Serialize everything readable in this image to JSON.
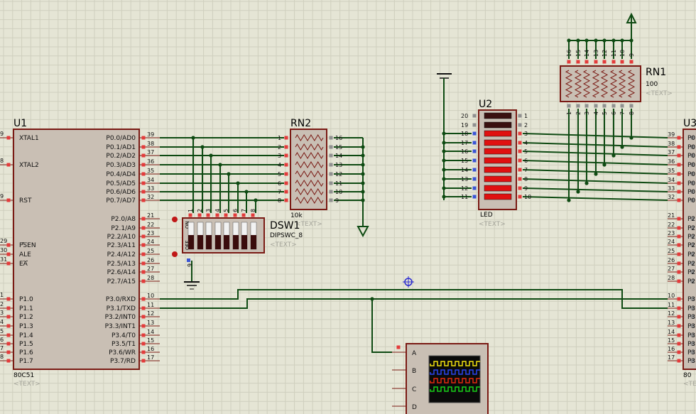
{
  "colors": {
    "background": "#e5e5d5",
    "grid": "#cfcfbe",
    "wire": "#0e4a12",
    "outline": "#7a1a14",
    "body_fill": "#c9bfb4",
    "pin_red": "#e43b3b",
    "pin_blue": "#3a55d6",
    "pin_grey": "#909090",
    "led_on": "#e01010",
    "led_off": "#3a1010",
    "text": "#111111",
    "placeholder": "#a4a49a",
    "origin_marker": "#2a2ad0"
  },
  "u1": {
    "ref": "U1",
    "part": "80C51",
    "text_tag": "<TEXT>",
    "left_pins": [
      {
        "num": "9",
        "name": "XTAL1"
      },
      {
        "num": "8",
        "name": "XTAL2"
      },
      {
        "num": "9",
        "name": "RST"
      },
      {
        "num": "29",
        "name": "PSEN"
      },
      {
        "num": "30",
        "name": "ALE"
      },
      {
        "num": "31",
        "name": "EA"
      },
      {
        "num": "1",
        "name": "P1.0"
      },
      {
        "num": "2",
        "name": "P1.1"
      },
      {
        "num": "3",
        "name": "P1.2"
      },
      {
        "num": "4",
        "name": "P1.3"
      },
      {
        "num": "5",
        "name": "P1.4"
      },
      {
        "num": "6",
        "name": "P1.5"
      },
      {
        "num": "7",
        "name": "P1.6"
      },
      {
        "num": "8",
        "name": "P1.7"
      }
    ],
    "right_pins": [
      {
        "num": "39",
        "name": "P0.0/AD0"
      },
      {
        "num": "38",
        "name": "P0.1/AD1"
      },
      {
        "num": "37",
        "name": "P0.2/AD2"
      },
      {
        "num": "36",
        "name": "P0.3/AD3"
      },
      {
        "num": "35",
        "name": "P0.4/AD4"
      },
      {
        "num": "34",
        "name": "P0.5/AD5"
      },
      {
        "num": "33",
        "name": "P0.6/AD6"
      },
      {
        "num": "32",
        "name": "P0.7/AD7"
      },
      {
        "num": "21",
        "name": "P2.0/A8"
      },
      {
        "num": "22",
        "name": "P2.1/A9"
      },
      {
        "num": "23",
        "name": "P2.2/A10"
      },
      {
        "num": "24",
        "name": "P2.3/A11"
      },
      {
        "num": "25",
        "name": "P2.4/A12"
      },
      {
        "num": "26",
        "name": "P2.5/A13"
      },
      {
        "num": "27",
        "name": "P2.6/A14"
      },
      {
        "num": "28",
        "name": "P2.7/A15"
      },
      {
        "num": "10",
        "name": "P3.0/RXD"
      },
      {
        "num": "11",
        "name": "P3.1/TXD"
      },
      {
        "num": "12",
        "name": "P3.2/INT0"
      },
      {
        "num": "13",
        "name": "P3.3/INT1"
      },
      {
        "num": "14",
        "name": "P3.4/T0"
      },
      {
        "num": "15",
        "name": "P3.5/T1"
      },
      {
        "num": "16",
        "name": "P3.6/WR"
      },
      {
        "num": "17",
        "name": "P3.7/RD"
      }
    ]
  },
  "rn2": {
    "ref": "RN2",
    "value": "10k",
    "text_tag": "<TEXT>",
    "left_nums": [
      "1",
      "2",
      "3",
      "4",
      "5",
      "6",
      "7",
      "8"
    ],
    "right_nums": [
      "16",
      "15",
      "14",
      "13",
      "12",
      "11",
      "10",
      "9"
    ]
  },
  "dsw1": {
    "ref": "DSW1",
    "part": "DIPSWC_8",
    "text_tag": "<TEXT>",
    "on_label": "ON",
    "off_label": "OFF",
    "top_nums": [
      "1",
      "2",
      "3",
      "4",
      "5",
      "6",
      "7",
      "8"
    ],
    "bottom_num": "9"
  },
  "u2": {
    "ref": "U2",
    "part": "LED",
    "text_tag": "<TEXT>",
    "left_nums": [
      "20",
      "19",
      "18",
      "17",
      "16",
      "15",
      "14",
      "13",
      "12",
      "11"
    ],
    "right_nums": [
      "1",
      "2",
      "3",
      "4",
      "5",
      "6",
      "7",
      "8",
      "9",
      "10"
    ],
    "segments_on": [
      0,
      0,
      1,
      1,
      1,
      1,
      1,
      1,
      1,
      1
    ]
  },
  "rn1": {
    "ref": "RN1",
    "value": "100",
    "text_tag": "<TEXT>",
    "top_nums": [
      "16",
      "15",
      "14",
      "13",
      "12",
      "11",
      "10",
      "9"
    ],
    "bottom_nums": [
      "1",
      "2",
      "3",
      "4",
      "5",
      "6",
      "7",
      "8"
    ]
  },
  "u3": {
    "ref": "U3",
    "part_visible": "80",
    "text_tag": "<TE",
    "right_nums": [
      "39",
      "38",
      "37",
      "36",
      "35",
      "34",
      "33",
      "32",
      "21",
      "22",
      "23",
      "24",
      "25",
      "26",
      "27",
      "28",
      "10",
      "11",
      "12",
      "13",
      "14",
      "15",
      "16",
      "17"
    ],
    "cut_labels": [
      "P0",
      "P0",
      "P0",
      "P0",
      "P0",
      "P0",
      "P0",
      "P0",
      "P2",
      "P2",
      "P2",
      "P2",
      "P2",
      "P2",
      "P2",
      "P2",
      "P3",
      "P3",
      "P3",
      "P3",
      "P3",
      "P3",
      "P3",
      "P3"
    ]
  },
  "oscilloscope": {
    "channels": [
      "A",
      "B",
      "C",
      "D"
    ],
    "trace_colors": [
      "#f0e010",
      "#2a44f0",
      "#e02a10",
      "#18d018"
    ]
  }
}
